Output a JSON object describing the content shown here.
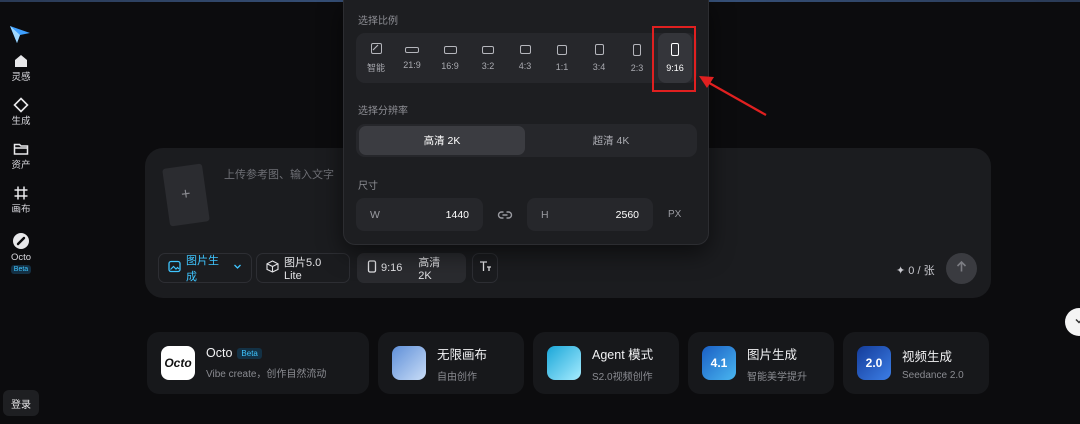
{
  "sidebar": {
    "items": [
      {
        "label": "灵感",
        "icon": "home-icon"
      },
      {
        "label": "生成",
        "icon": "diamond-icon"
      },
      {
        "label": "资产",
        "icon": "folder-icon"
      },
      {
        "label": "画布",
        "icon": "grid-icon"
      },
      {
        "label": "Octo",
        "icon": "octo-icon",
        "badge": "Beta"
      }
    ],
    "login_label": "登录"
  },
  "popup": {
    "ratio_title": "选择比例",
    "ratios": [
      {
        "label": "智能",
        "selected": false
      },
      {
        "label": "21:9",
        "selected": false
      },
      {
        "label": "16:9",
        "selected": false
      },
      {
        "label": "3:2",
        "selected": false
      },
      {
        "label": "4:3",
        "selected": false
      },
      {
        "label": "1:1",
        "selected": false
      },
      {
        "label": "3:4",
        "selected": false
      },
      {
        "label": "2:3",
        "selected": false
      },
      {
        "label": "9:16",
        "selected": true
      }
    ],
    "resolution_title": "选择分辨率",
    "resolutions": [
      {
        "label": "高清 2K",
        "active": true
      },
      {
        "label": "超清 4K",
        "active": false
      }
    ],
    "size_title": "尺寸",
    "width_key": "W",
    "width_value": "1440",
    "height_key": "H",
    "height_value": "2560",
    "unit": "PX"
  },
  "composer": {
    "upload_icon": "+",
    "placeholder": "上传参考图、输入文字",
    "mode_label": "图片生成",
    "model_label": "图片5.0 Lite",
    "ratio_label": "9:16",
    "resolution_label": "高清 2K",
    "credits": "0 / 张"
  },
  "features": [
    {
      "title": "Octo",
      "badge": "Beta",
      "subtitle": "Vibe create，创作自然流动",
      "thumb_text": "Octo",
      "thumb_color": "#ffffff"
    },
    {
      "title": "无限画布",
      "subtitle": "自由创作",
      "thumb_text": "",
      "thumb_color": "#7aa7e8"
    },
    {
      "title": "Agent 模式",
      "subtitle": "S2.0视频创作",
      "thumb_text": "",
      "thumb_color": "#2fc0e0"
    },
    {
      "title": "图片生成",
      "subtitle": "智能美学提升",
      "thumb_text": "4.1",
      "thumb_color": "#1f6fd6"
    },
    {
      "title": "视频生成",
      "subtitle": "Seedance 2.0",
      "thumb_text": "2.0",
      "thumb_color": "#1f4fb0"
    }
  ],
  "colors": {
    "accent": "#3fc5ff",
    "highlight": "#e02020",
    "background": "#0c0c0e"
  }
}
